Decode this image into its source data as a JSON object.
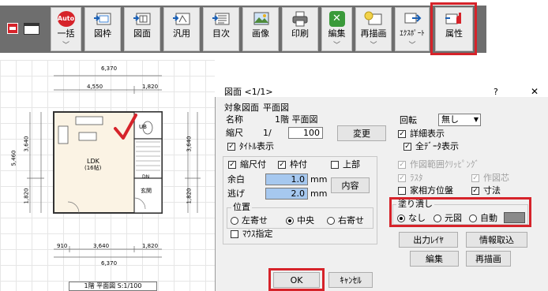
{
  "toolbar": {
    "colors": {
      "accent": "#d6232a",
      "strip": "#6e6e6e"
    },
    "left_icons": [
      "printer-icon",
      "window-icon"
    ],
    "buttons": [
      {
        "label": "一括",
        "badge": "Auto",
        "icon": "auto-badge-icon",
        "dropdown": true
      },
      {
        "label": "図枠",
        "icon": "frame-icon",
        "dropdown": false
      },
      {
        "label": "図面",
        "icon": "drawing-icon",
        "dropdown": false
      },
      {
        "label": "汎用",
        "icon": "general-icon",
        "dropdown": false
      },
      {
        "label": "目次",
        "icon": "index-icon",
        "dropdown": false
      },
      {
        "label": "画像",
        "icon": "image-icon",
        "dropdown": false
      },
      {
        "label": "印刷",
        "icon": "printer-icon",
        "dropdown": false
      },
      {
        "label": "編集",
        "icon": "wrench-icon",
        "dropdown": true
      },
      {
        "label": "再描画",
        "icon": "redraw-icon",
        "dropdown": true
      },
      {
        "label": "ｴｸｽﾎﾟｰﾄ",
        "icon": "export-icon",
        "dropdown": true
      },
      {
        "label": "属性",
        "icon": "attribute-icon",
        "dropdown": false
      }
    ]
  },
  "plan": {
    "caption": "1階 平面図 S:1/100",
    "dims_top": [
      "6,370",
      "4,550",
      "1,820"
    ],
    "dims_bottom": [
      "910",
      "3,640",
      "1,820",
      "6,370"
    ],
    "dims_left": [
      "3,640",
      "5,460",
      "1,820"
    ],
    "dims_right": [
      "3,640",
      "1,820"
    ],
    "rooms": [
      "LDK",
      "(16帖)",
      "UB",
      "玄関",
      "DN"
    ]
  },
  "dialog": {
    "title": "図面 <1/1>",
    "help": "?",
    "close": "✕",
    "target_label": "対象図面",
    "target_value": "平面図",
    "name_label": "名称",
    "name_value": "1階 平面図",
    "scale_label": "縮尺",
    "scale_prefix": "1/",
    "scale_value": "100",
    "change_button": "変更",
    "title_display": "ﾀｲﾄﾙ表示",
    "rotate_label": "回転",
    "rotate_value": "無し",
    "detail_display": "詳細表示",
    "all_data_display": "全ﾃﾞｰﾀ表示",
    "scale_with": "縮尺付",
    "frame_with": "枠付",
    "upper": "上部",
    "margin_label": "余白",
    "margin_value": "1.0",
    "margin_unit": "mm",
    "escape_label": "逃げ",
    "escape_value": "2.0",
    "escape_unit": "mm",
    "content_button": "内容",
    "position_legend": "位置",
    "pos_left": "左寄せ",
    "pos_center": "中央",
    "pos_right": "右寄せ",
    "mouse_spec": "ﾏｳｽ指定",
    "clip": "作図範囲ｸﾘｯﾋﾟﾝｸﾞ",
    "raster": "ﾗｽﾀ",
    "draw_center": "作図芯",
    "house_phase": "家相方位盤",
    "dimension": "寸法",
    "fill_legend": "塗り潰し",
    "fill_none": "なし",
    "fill_original": "元図",
    "fill_auto": "自動",
    "fill_color": "#8a8a8a",
    "output_layer": "出力ﾚｲﾔ",
    "info_import": "情報取込",
    "edit": "編集",
    "redraw": "再描画",
    "ok": "OK",
    "cancel": "ｷｬﾝｾﾙ"
  }
}
